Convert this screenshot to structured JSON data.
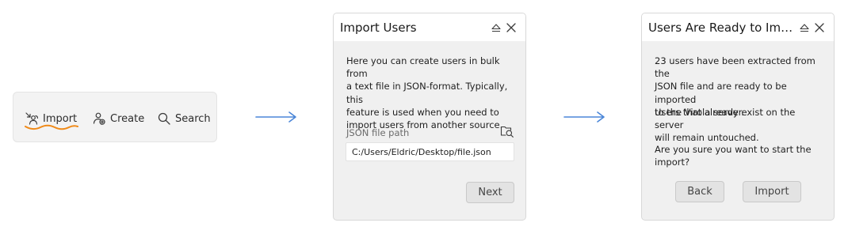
{
  "toolbar": {
    "items": [
      {
        "label": "Import",
        "icon": "import-users-icon"
      },
      {
        "label": "Create",
        "icon": "create-user-icon"
      },
      {
        "label": "Search",
        "icon": "search-icon"
      }
    ],
    "accent_color": "#f08a18"
  },
  "arrows": {
    "color": "#4a86d8"
  },
  "dialog_import": {
    "title": "Import Users",
    "description_lines": [
      "Here you can create users in bulk from",
      "a text file in JSON-format. Typically, this",
      "feature is used when you need to",
      "import users from another source."
    ],
    "field_label": "JSON file path",
    "path_value": "C:/Users/Eldric/Desktop/file.json",
    "next_label": "Next"
  },
  "dialog_confirm": {
    "title": "Users Are Ready to Impo…",
    "para1_lines": [
      "23 users have been extracted from the",
      "JSON file and are ready to be imported",
      "to the Virola server."
    ],
    "para2_lines": [
      "Users that already exist on the server",
      "will remain untouched."
    ],
    "para3_lines": [
      "Are you sure you want to start the",
      "import?"
    ],
    "back_label": "Back",
    "import_label": "Import"
  }
}
